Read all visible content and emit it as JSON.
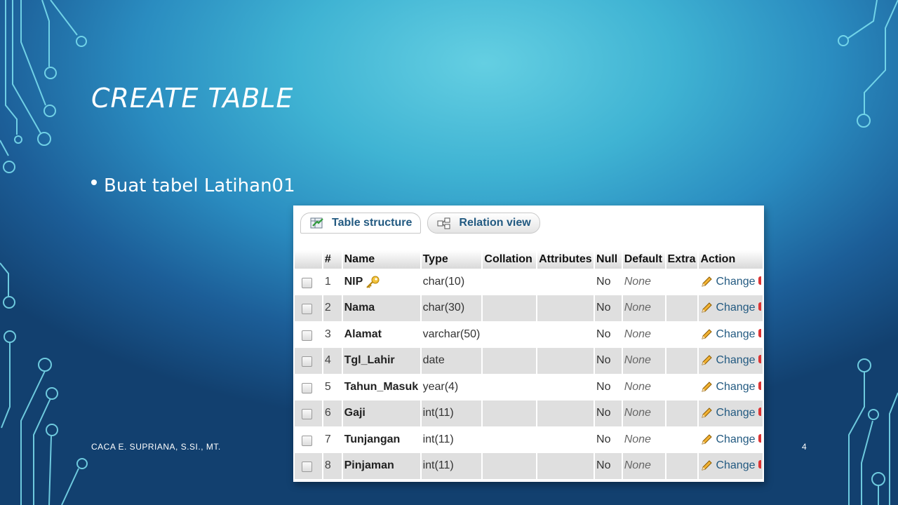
{
  "slide": {
    "title": "CREATE TABLE",
    "bullet": "Buat tabel Latihan01",
    "footer": "CACA E. SUPRIANA, S.SI., MT.",
    "page_number": "4"
  },
  "phpmyadmin": {
    "tabs": [
      {
        "label": "Table structure",
        "icon": "table-structure-icon"
      },
      {
        "label": "Relation view",
        "icon": "relation-view-icon"
      }
    ],
    "columns": [
      "#",
      "Name",
      "Type",
      "Collation",
      "Attributes",
      "Null",
      "Default",
      "Extra",
      "Action"
    ],
    "rows": [
      {
        "num": "1",
        "name": "NIP",
        "type": "char(10)",
        "null": "No",
        "default": "None",
        "action": "Change",
        "primary_key": true
      },
      {
        "num": "2",
        "name": "Nama",
        "type": "char(30)",
        "null": "No",
        "default": "None",
        "action": "Change"
      },
      {
        "num": "3",
        "name": "Alamat",
        "type": "varchar(50)",
        "null": "No",
        "default": "None",
        "action": "Change"
      },
      {
        "num": "4",
        "name": "Tgl_Lahir",
        "type": "date",
        "null": "No",
        "default": "None",
        "action": "Change"
      },
      {
        "num": "5",
        "name": "Tahun_Masuk",
        "type": "year(4)",
        "null": "No",
        "default": "None",
        "action": "Change"
      },
      {
        "num": "6",
        "name": "Gaji",
        "type": "int(11)",
        "null": "No",
        "default": "None",
        "action": "Change"
      },
      {
        "num": "7",
        "name": "Tunjangan",
        "type": "int(11)",
        "null": "No",
        "default": "None",
        "action": "Change"
      },
      {
        "num": "8",
        "name": "Pinjaman",
        "type": "int(11)",
        "null": "No",
        "default": "None",
        "action": "Change"
      }
    ]
  },
  "colors": {
    "circuit_line": "#7fe3f2",
    "link": "#235a81"
  }
}
